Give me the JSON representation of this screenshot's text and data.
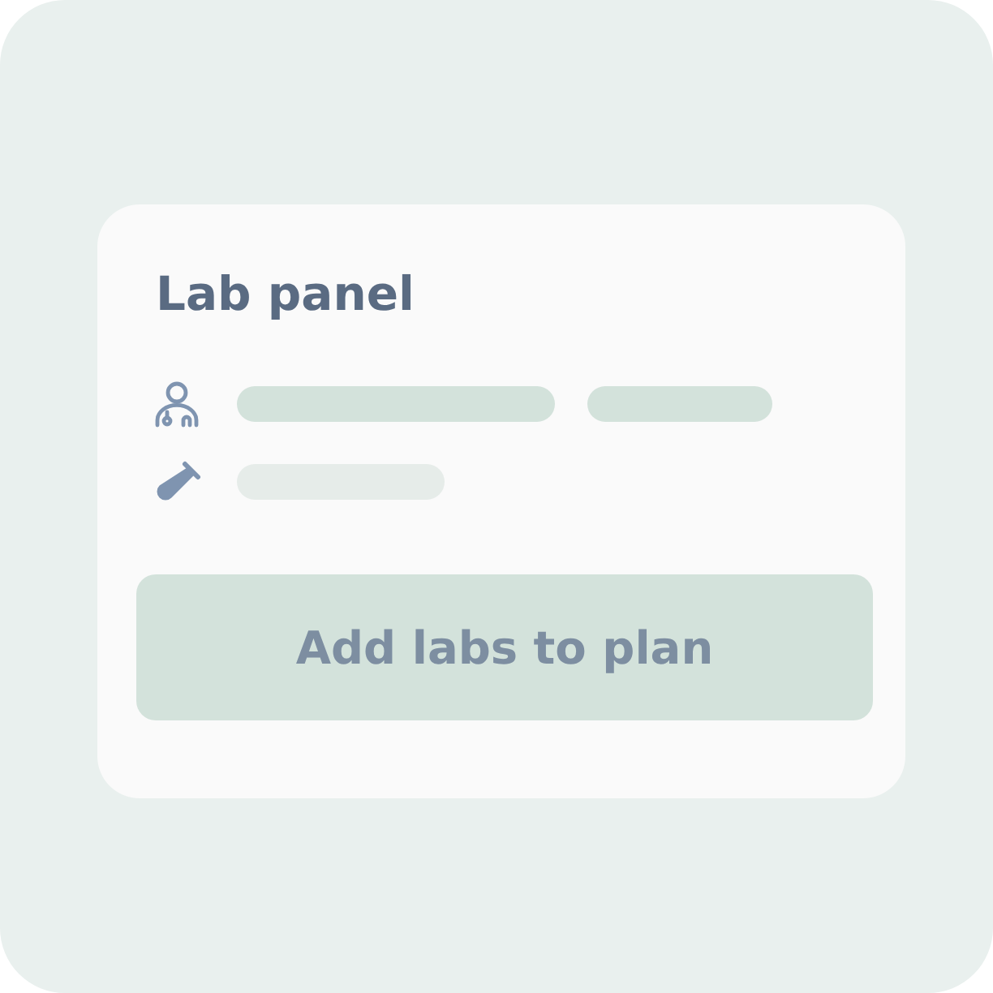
{
  "card": {
    "title": "Lab panel",
    "rows": [
      {
        "kind": "clinician"
      },
      {
        "kind": "lab"
      }
    ],
    "button": "Add labs to plan"
  }
}
